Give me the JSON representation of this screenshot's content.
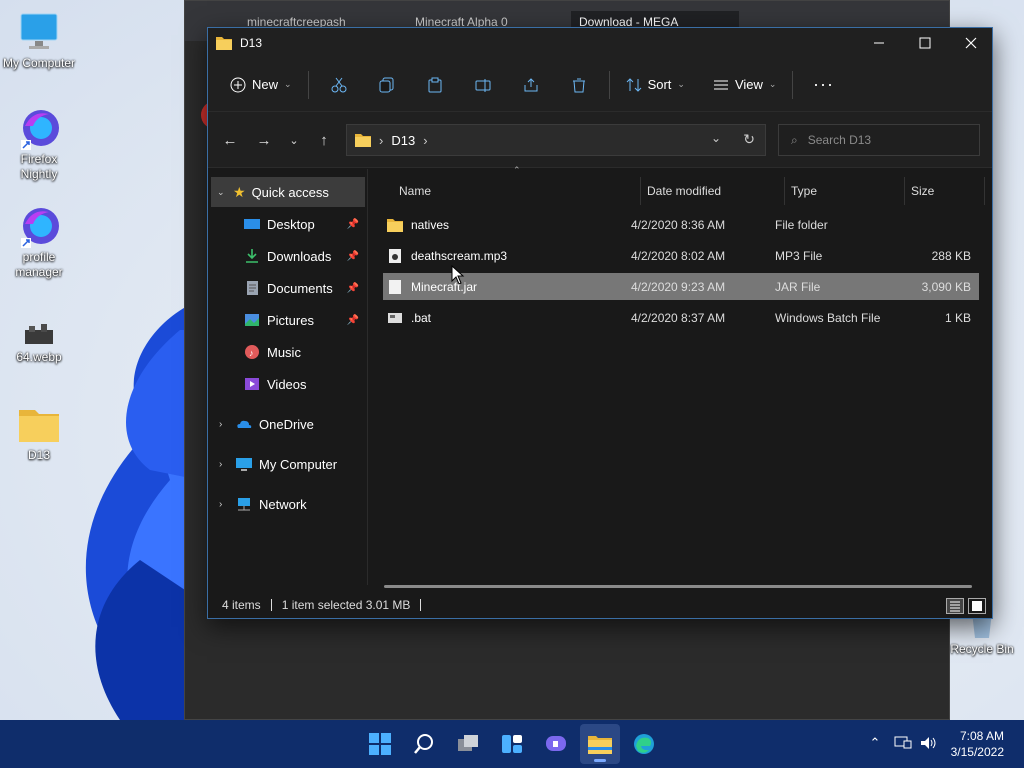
{
  "desktop": {
    "icons": [
      {
        "name": "my-computer",
        "label": "My Computer"
      },
      {
        "name": "firefox-nightly",
        "label": "Firefox Nightly"
      },
      {
        "name": "profile-manager",
        "label": "profile manager"
      },
      {
        "name": "webp-file",
        "label": "64.webp"
      },
      {
        "name": "d13-folder",
        "label": "D13"
      },
      {
        "name": "recycle-bin",
        "label": "Recycle Bin"
      }
    ]
  },
  "browser": {
    "tabs": [
      {
        "label": "minecraftcreepash"
      },
      {
        "label": "Minecraft Alpha 0"
      },
      {
        "label": "Download - MEGA"
      }
    ]
  },
  "explorer": {
    "title": "D13",
    "commands": {
      "new": "New",
      "sort": "Sort",
      "view": "View"
    },
    "address": {
      "crumb": "D13"
    },
    "search": {
      "placeholder": "Search D13"
    },
    "nav": [
      {
        "label": "Quick access"
      },
      {
        "label": "Desktop"
      },
      {
        "label": "Downloads"
      },
      {
        "label": "Documents"
      },
      {
        "label": "Pictures"
      },
      {
        "label": "Music"
      },
      {
        "label": "Videos"
      },
      {
        "label": "OneDrive"
      },
      {
        "label": "My Computer"
      },
      {
        "label": "Network"
      }
    ],
    "columns": {
      "name": "Name",
      "date": "Date modified",
      "type": "Type",
      "size": "Size"
    },
    "files": [
      {
        "name": "natives",
        "date": "4/2/2020 8:36 AM",
        "type": "File folder",
        "size": ""
      },
      {
        "name": "deathscream.mp3",
        "date": "4/2/2020 8:02 AM",
        "type": "MP3 File",
        "size": "288 KB"
      },
      {
        "name": "Minecraft.jar",
        "date": "4/2/2020 9:23 AM",
        "type": "JAR File",
        "size": "3,090 KB"
      },
      {
        "name": ".bat",
        "date": "4/2/2020 8:37 AM",
        "type": "Windows Batch File",
        "size": "1 KB"
      }
    ],
    "status": {
      "count": "4 items",
      "selected": "1 item selected  3.01 MB"
    }
  },
  "taskbar": {
    "time": "7:08 AM",
    "date": "3/15/2022",
    "apps": [
      "start-icon",
      "search-icon",
      "task-view-icon",
      "widgets-icon",
      "chat-icon",
      "file-explorer-icon",
      "edge-icon"
    ]
  },
  "colors": {
    "taskbar": "#0f2d6b",
    "accent": "#7aa9ff",
    "explorer_bg": "#191919",
    "folder": "#f5c542"
  }
}
